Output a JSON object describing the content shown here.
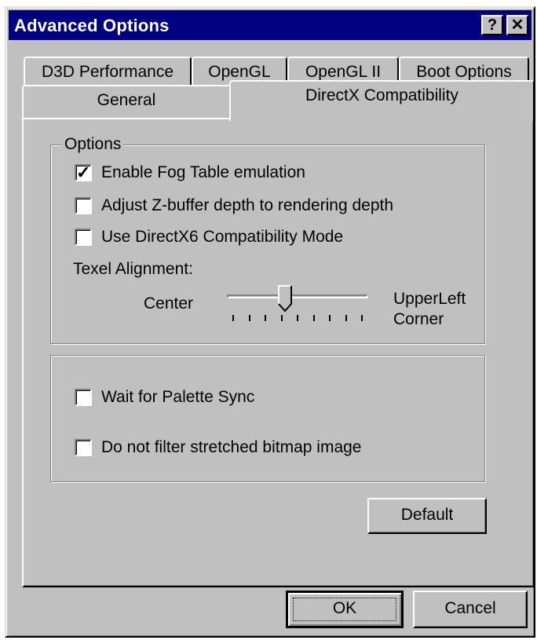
{
  "window": {
    "title": "Advanced Options",
    "help_glyph": "?",
    "close_glyph": "✕"
  },
  "tabs_back": [
    {
      "label": "D3D Performance"
    },
    {
      "label": "OpenGL"
    },
    {
      "label": "OpenGL II"
    },
    {
      "label": "Boot Options"
    }
  ],
  "tabs_front": [
    {
      "label": "General"
    },
    {
      "label": "DirectX Compatibility",
      "selected": true
    }
  ],
  "options_group": {
    "label": "Options",
    "checkboxes": [
      {
        "label": "Enable Fog Table emulation",
        "checked": true
      },
      {
        "label": "Adjust Z-buffer depth to rendering depth",
        "checked": false
      },
      {
        "label": "Use DirectX6 Compatibility Mode",
        "checked": false
      }
    ],
    "texel_label": "Texel Alignment:",
    "slider_left_label": "Center",
    "slider_right_label_1": "UpperLeft",
    "slider_right_label_2": "Corner",
    "slider_position": 0.4,
    "slider_ticks": 9
  },
  "second_group": {
    "checkboxes": [
      {
        "label": "Wait for Palette Sync",
        "checked": false
      },
      {
        "label": "Do not filter stretched bitmap image",
        "checked": false
      }
    ]
  },
  "buttons": {
    "default": "Default",
    "ok": "OK",
    "cancel": "Cancel"
  },
  "colors": {
    "face": "#c0c0c0",
    "titlebar": "#000080"
  }
}
